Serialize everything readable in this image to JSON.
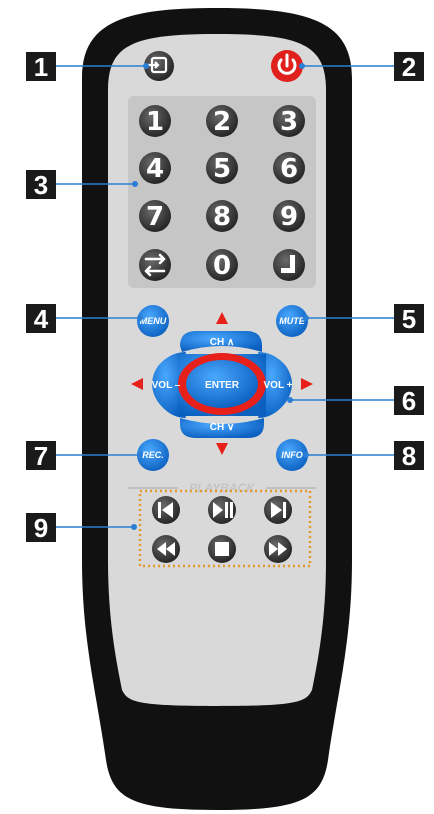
{
  "callouts": [
    "1",
    "2",
    "3",
    "4",
    "5",
    "6",
    "7",
    "8",
    "9"
  ],
  "top_buttons": {
    "left_icon": "input-source-icon",
    "right_icon": "power-icon"
  },
  "numpad": {
    "keys": [
      "1",
      "2",
      "3",
      "4",
      "5",
      "6",
      "7",
      "8",
      "9",
      "",
      "0",
      ""
    ],
    "left_bottom_icon": "swap-icon",
    "right_bottom_icon": "enter-return-icon"
  },
  "buttons": {
    "menu": "MENU",
    "mute": "MUTE",
    "rec": "REC.",
    "info": "INFO"
  },
  "dpad": {
    "up": "CH ∧",
    "down": "CH ∨",
    "left": "VOL –",
    "right": "VOL +",
    "center": "ENTER"
  },
  "playback": {
    "label": "PLAYBACK",
    "icons": [
      "previous-icon",
      "play-pause-icon",
      "next-icon",
      "rewind-icon",
      "stop-icon",
      "fast-forward-icon"
    ]
  },
  "colors": {
    "remote_body": "#111111",
    "face_plate": "#d9d9d9",
    "numpad_panel": "#c6c6c6",
    "dark_button": "#3a3a3a",
    "blue": "#1277d6",
    "red": "#e8201a",
    "power_red": "#e0201c",
    "callout_box": "#1a1a1a",
    "leader_line": "#2a7fd4",
    "dots": "#e39a2b"
  }
}
